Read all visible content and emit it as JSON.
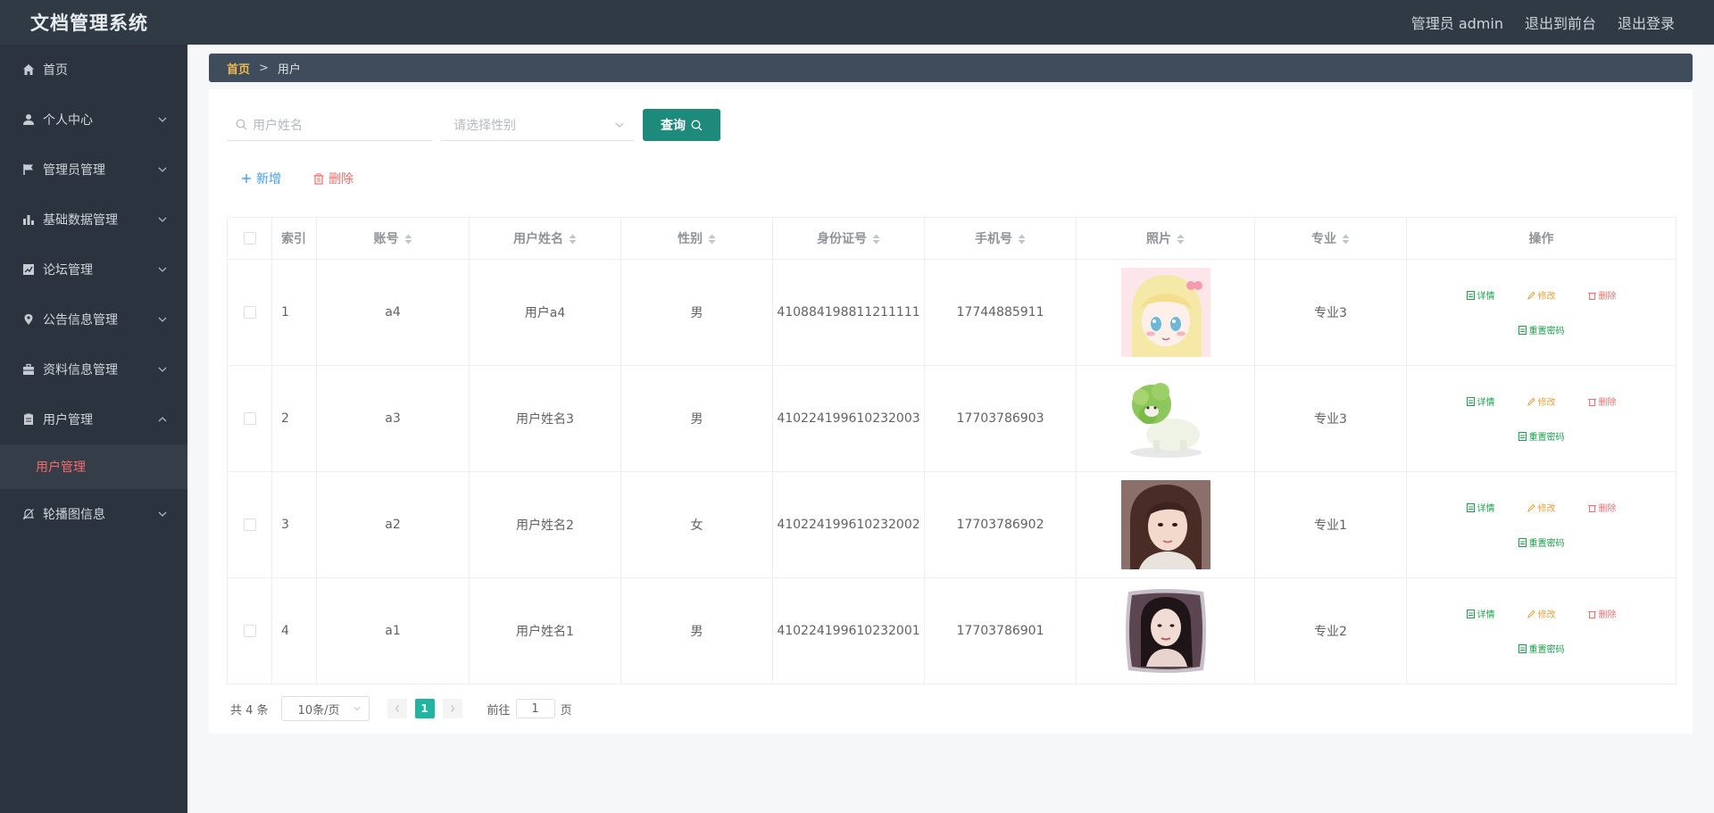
{
  "app": {
    "title": "文档管理系统"
  },
  "topbar": {
    "user_label": "管理员 admin",
    "to_front": "退出到前台",
    "logout": "退出登录"
  },
  "sidebar": {
    "items": [
      {
        "label": "首页",
        "icon": "home-icon"
      },
      {
        "label": "个人中心",
        "icon": "user-icon"
      },
      {
        "label": "管理员管理",
        "icon": "flag-icon"
      },
      {
        "label": "基础数据管理",
        "icon": "bar-chart-icon"
      },
      {
        "label": "论坛管理",
        "icon": "trend-icon"
      },
      {
        "label": "公告信息管理",
        "icon": "location-icon"
      },
      {
        "label": "资料信息管理",
        "icon": "briefcase-icon"
      },
      {
        "label": "用户管理",
        "icon": "document-icon"
      },
      {
        "label": "轮播图信息",
        "icon": "bell-off-icon"
      }
    ],
    "submenu_active": "用户管理"
  },
  "breadcrumb": {
    "home": "首页",
    "separator": ">",
    "current": "用户"
  },
  "search": {
    "name_placeholder": "用户姓名",
    "gender_placeholder": "请选择性别",
    "query_label": "查询"
  },
  "actions": {
    "add_label": "新增",
    "delete_label": "删除"
  },
  "table": {
    "headers": {
      "index": "索引",
      "account": "账号",
      "name": "用户姓名",
      "gender": "性别",
      "id_number": "身份证号",
      "phone": "手机号",
      "photo": "照片",
      "major": "专业",
      "ops": "操作"
    },
    "rows": [
      {
        "index": "1",
        "account": "a4",
        "name": "用户a4",
        "gender": "男",
        "id_number": "410884198811211111",
        "phone": "17744885911",
        "major": "专业3"
      },
      {
        "index": "2",
        "account": "a3",
        "name": "用户姓名3",
        "gender": "男",
        "id_number": "410224199610232003",
        "phone": "17703786903",
        "major": "专业3"
      },
      {
        "index": "3",
        "account": "a2",
        "name": "用户姓名2",
        "gender": "女",
        "id_number": "410224199610232002",
        "phone": "17703786902",
        "major": "专业1"
      },
      {
        "index": "4",
        "account": "a1",
        "name": "用户姓名1",
        "gender": "男",
        "id_number": "410224199610232001",
        "phone": "17703786901",
        "major": "专业2"
      }
    ],
    "op_labels": {
      "detail": "详情",
      "edit": "修改",
      "delete": "删除",
      "reset": "重置密码"
    }
  },
  "pagination": {
    "total_text": "共 4 条",
    "page_size": "10条/页",
    "current_page": "1",
    "goto_prefix": "前往",
    "goto_value": "1",
    "goto_suffix": "页"
  },
  "colors": {
    "topbar": "#303a45",
    "sidebar": "#2b333e",
    "accent_teal": "#1e8a7c",
    "active_red": "#f56c6c",
    "link_blue": "#409eff"
  }
}
